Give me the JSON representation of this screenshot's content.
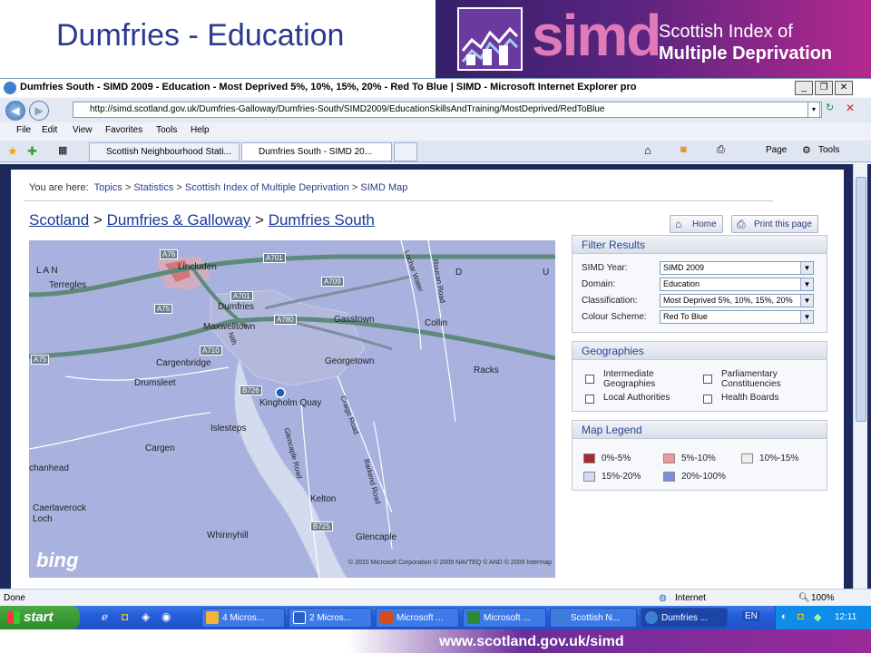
{
  "slide": {
    "title": "Dumfries - Education",
    "brand_simd": "simd",
    "brand_line1": "Scottish Index of",
    "brand_line2": "Multiple Deprivation",
    "footer_url": "www.scotland.gov.uk/simd"
  },
  "browser": {
    "window_title": "Dumfries South - SIMD 2009 - Education - Most Deprived 5%, 10%, 15%, 20% - Red To Blue | SIMD - Microsoft Internet Explorer pro",
    "url": "http://simd.scotland.gov.uk/Dumfries-Galloway/Dumfries-South/SIMD2009/EducationSkillsAndTraining/MostDeprived/RedToBlue",
    "menu": [
      "File",
      "Edit",
      "View",
      "Favorites",
      "Tools",
      "Help"
    ],
    "tabs": [
      {
        "label": "Scottish Neighbourhood Stati..."
      },
      {
        "label": "Dumfries South - SIMD 20..."
      }
    ],
    "commands": {
      "page": "Page",
      "tools": "Tools"
    },
    "status": {
      "left": "Done",
      "zone": "Internet",
      "zoom": "100%"
    }
  },
  "page": {
    "crumbs_prefix": "You are here:",
    "crumbs": [
      "Topics",
      "Statistics",
      "Scottish Index of Multiple Deprivation",
      "SIMD Map"
    ],
    "path": [
      "Scotland",
      "Dumfries & Galloway",
      "Dumfries South"
    ],
    "sep": ">",
    "home_button": "Home",
    "print_button": "Print this page"
  },
  "map": {
    "places": {
      "lincluden": "Lincluden",
      "terregles": "Terregles",
      "dumfries": "Dumfries",
      "maxwelltown": "Maxwelltown",
      "gasstown": "Gasstown",
      "collin": "Collin",
      "cargenbridge": "Cargenbridge",
      "georgetown": "Georgetown",
      "racks": "Racks",
      "drumsleet": "Drumsleet",
      "kingholm": "Kingholm Quay",
      "islesteps": "Islesteps",
      "cargen": "Cargen",
      "kelton": "Kelton",
      "cochanhead": "chanhead",
      "caerlaverock": "Caerlaverock",
      "loch": "Loch",
      "whinnyhill": "Whinnyhill",
      "glencaple": "Glencaple",
      "l_letters": "L    A    N",
      "d_letter": "D",
      "u_letter": "U",
      "crichton": "Lochar Water",
      "roucan": "Roucan Road",
      "craigs": "Craigs Road",
      "barkend": "Barkend Road",
      "glencaple_road": "Glencaple Road",
      "nith": "Nith"
    },
    "roads": {
      "a76": "A76",
      "a701": "A701",
      "a709": "A709",
      "a75": "A75",
      "a701b": "A701",
      "a780": "A780",
      "a710": "A710",
      "a75b": "A75",
      "b726": "B726",
      "b725": "B725"
    },
    "bing": "bing",
    "copyright": "© 2010 Microsoft Corporation   © 2009 NAVTEQ   © AND   © 2009 Intermap"
  },
  "filter": {
    "title": "Filter Results",
    "rows": [
      {
        "label": "SIMD Year:",
        "value": "SIMD 2009"
      },
      {
        "label": "Domain:",
        "value": "Education"
      },
      {
        "label": "Classification:",
        "value": "Most Deprived 5%, 10%, 15%, 20%"
      },
      {
        "label": "Colour Scheme:",
        "value": "Red To Blue"
      }
    ]
  },
  "geographies": {
    "title": "Geographies",
    "items": [
      {
        "label": "Intermediate Geographies"
      },
      {
        "label": "Local Authorities"
      },
      {
        "label": "Parliamentary Constituencies"
      },
      {
        "label": "Health Boards"
      }
    ]
  },
  "legend": {
    "title": "Map Legend",
    "items": [
      {
        "label": "0%-5%",
        "color": "#a8282c"
      },
      {
        "label": "5%-10%",
        "color": "#ee9a9a"
      },
      {
        "label": "10%-15%",
        "color": "#f3ecec"
      },
      {
        "label": "15%-20%",
        "color": "#d6daf5"
      },
      {
        "label": "20%-100%",
        "color": "#7b8fe0"
      }
    ]
  },
  "taskbar": {
    "start": "start",
    "buttons": [
      {
        "label": "4 Micros..."
      },
      {
        "label": "2 Micros..."
      },
      {
        "label": "Microsoft ..."
      },
      {
        "label": "Microsoft ..."
      },
      {
        "label": "Scottish N..."
      },
      {
        "label": "Dumfries ..."
      }
    ],
    "lang": "EN",
    "clock": "12:11"
  }
}
